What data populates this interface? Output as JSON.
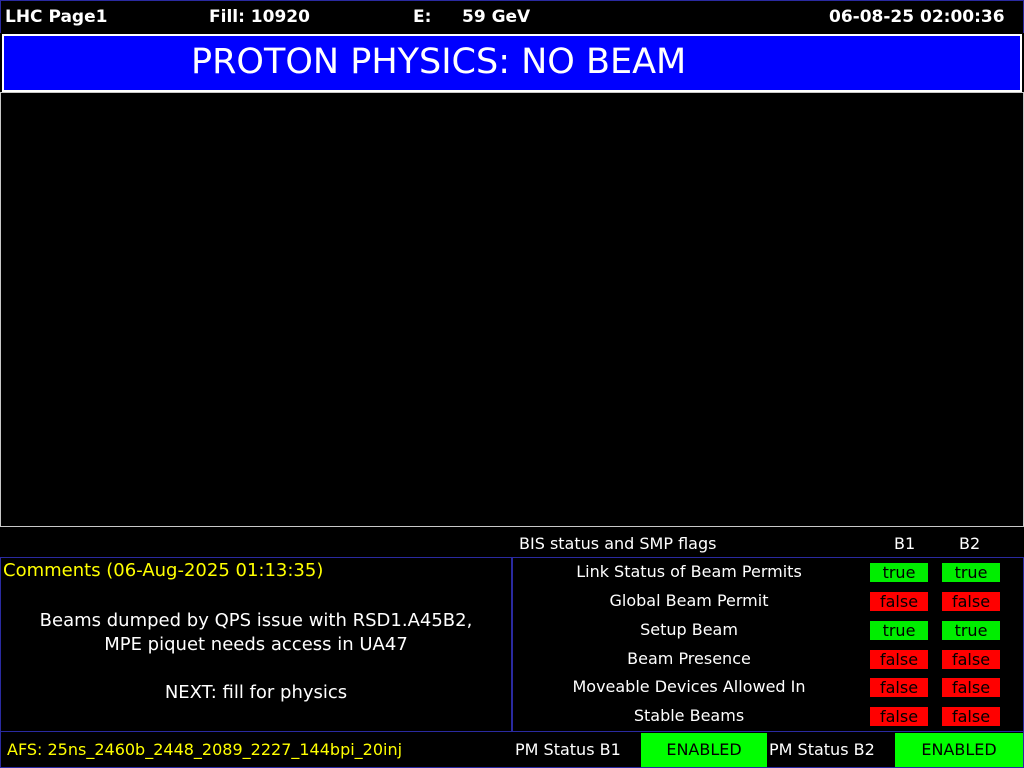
{
  "header": {
    "page_name": "LHC Page1",
    "fill_label": "Fill: 10920",
    "energy_label": "E:",
    "energy_value": "59 GeV",
    "datetime": "06-08-25 02:00:36"
  },
  "banner": {
    "mode": "PROTON PHYSICS: NO BEAM"
  },
  "bis": {
    "title": "BIS status and SMP flags",
    "col_b1": "B1",
    "col_b2": "B2",
    "rows": [
      {
        "label": "Link Status of Beam Permits",
        "b1": "true",
        "b2": "true"
      },
      {
        "label": "Global Beam Permit",
        "b1": "false",
        "b2": "false"
      },
      {
        "label": "Setup Beam",
        "b1": "true",
        "b2": "true"
      },
      {
        "label": "Beam Presence",
        "b1": "false",
        "b2": "false"
      },
      {
        "label": "Moveable Devices Allowed In",
        "b1": "false",
        "b2": "false"
      },
      {
        "label": "Stable Beams",
        "b1": "false",
        "b2": "false"
      }
    ]
  },
  "comments": {
    "title": "Comments (06-Aug-2025 01:13:35)",
    "lines": [
      "Beams dumped by QPS issue with RSD1.A45B2,",
      "MPE piquet needs access in UA47",
      "",
      "NEXT: fill for physics"
    ]
  },
  "footer": {
    "afs": "AFS: 25ns_2460b_2448_2089_2227_144bpi_20inj",
    "pm_b1_label": "PM Status B1",
    "pm_b1_value": "ENABLED",
    "pm_b2_label": "PM Status B2",
    "pm_b2_value": "ENABLED"
  },
  "colors": {
    "banner_bg": "#0000ff",
    "true_flag": "#00ee00",
    "false_flag": "#ff0000",
    "comment_text": "#ffff00",
    "enabled_bg": "#00ff00"
  }
}
